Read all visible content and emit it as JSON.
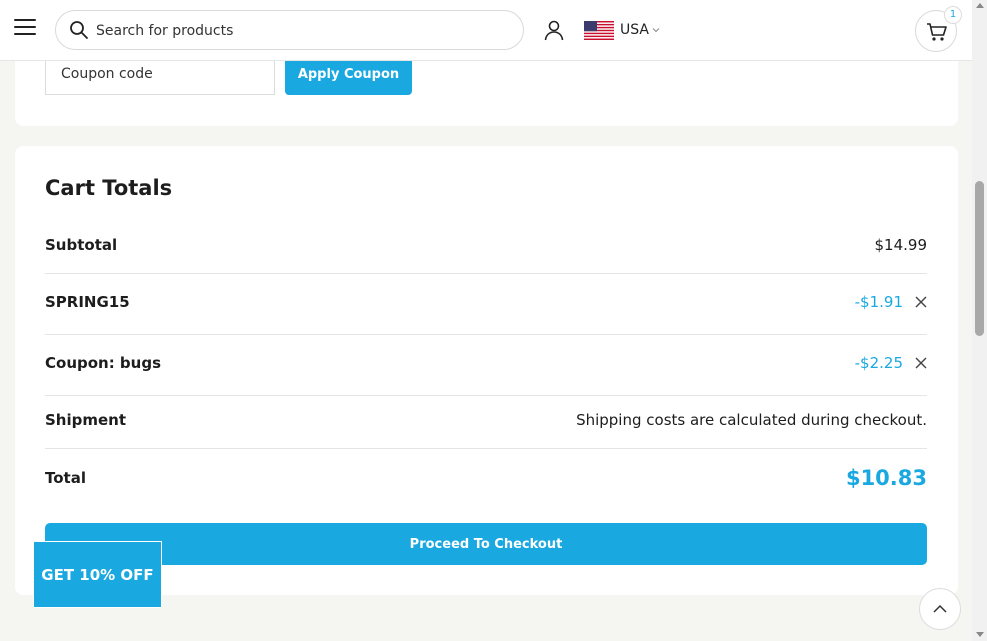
{
  "header": {
    "search_placeholder": "Search for products",
    "country": "USA",
    "cart_count": "1"
  },
  "coupon": {
    "input_placeholder": "Coupon code",
    "apply_label": "Apply Coupon"
  },
  "totals": {
    "title": "Cart Totals",
    "subtotal_label": "Subtotal",
    "subtotal_value": "$14.99",
    "discount1_label": "SPRING15",
    "discount1_value": "-$1.91",
    "discount2_label": "Coupon: bugs",
    "discount2_value": "-$2.25",
    "shipment_label": "Shipment",
    "shipment_value": "Shipping costs are calculated during checkout.",
    "total_label": "Total",
    "total_value": "$10.83",
    "checkout_label": "Proceed To Checkout"
  },
  "promo": {
    "label": "GET 10% OFF"
  },
  "colors": {
    "accent": "#1aa8e1",
    "background": "#f5f6f1"
  }
}
